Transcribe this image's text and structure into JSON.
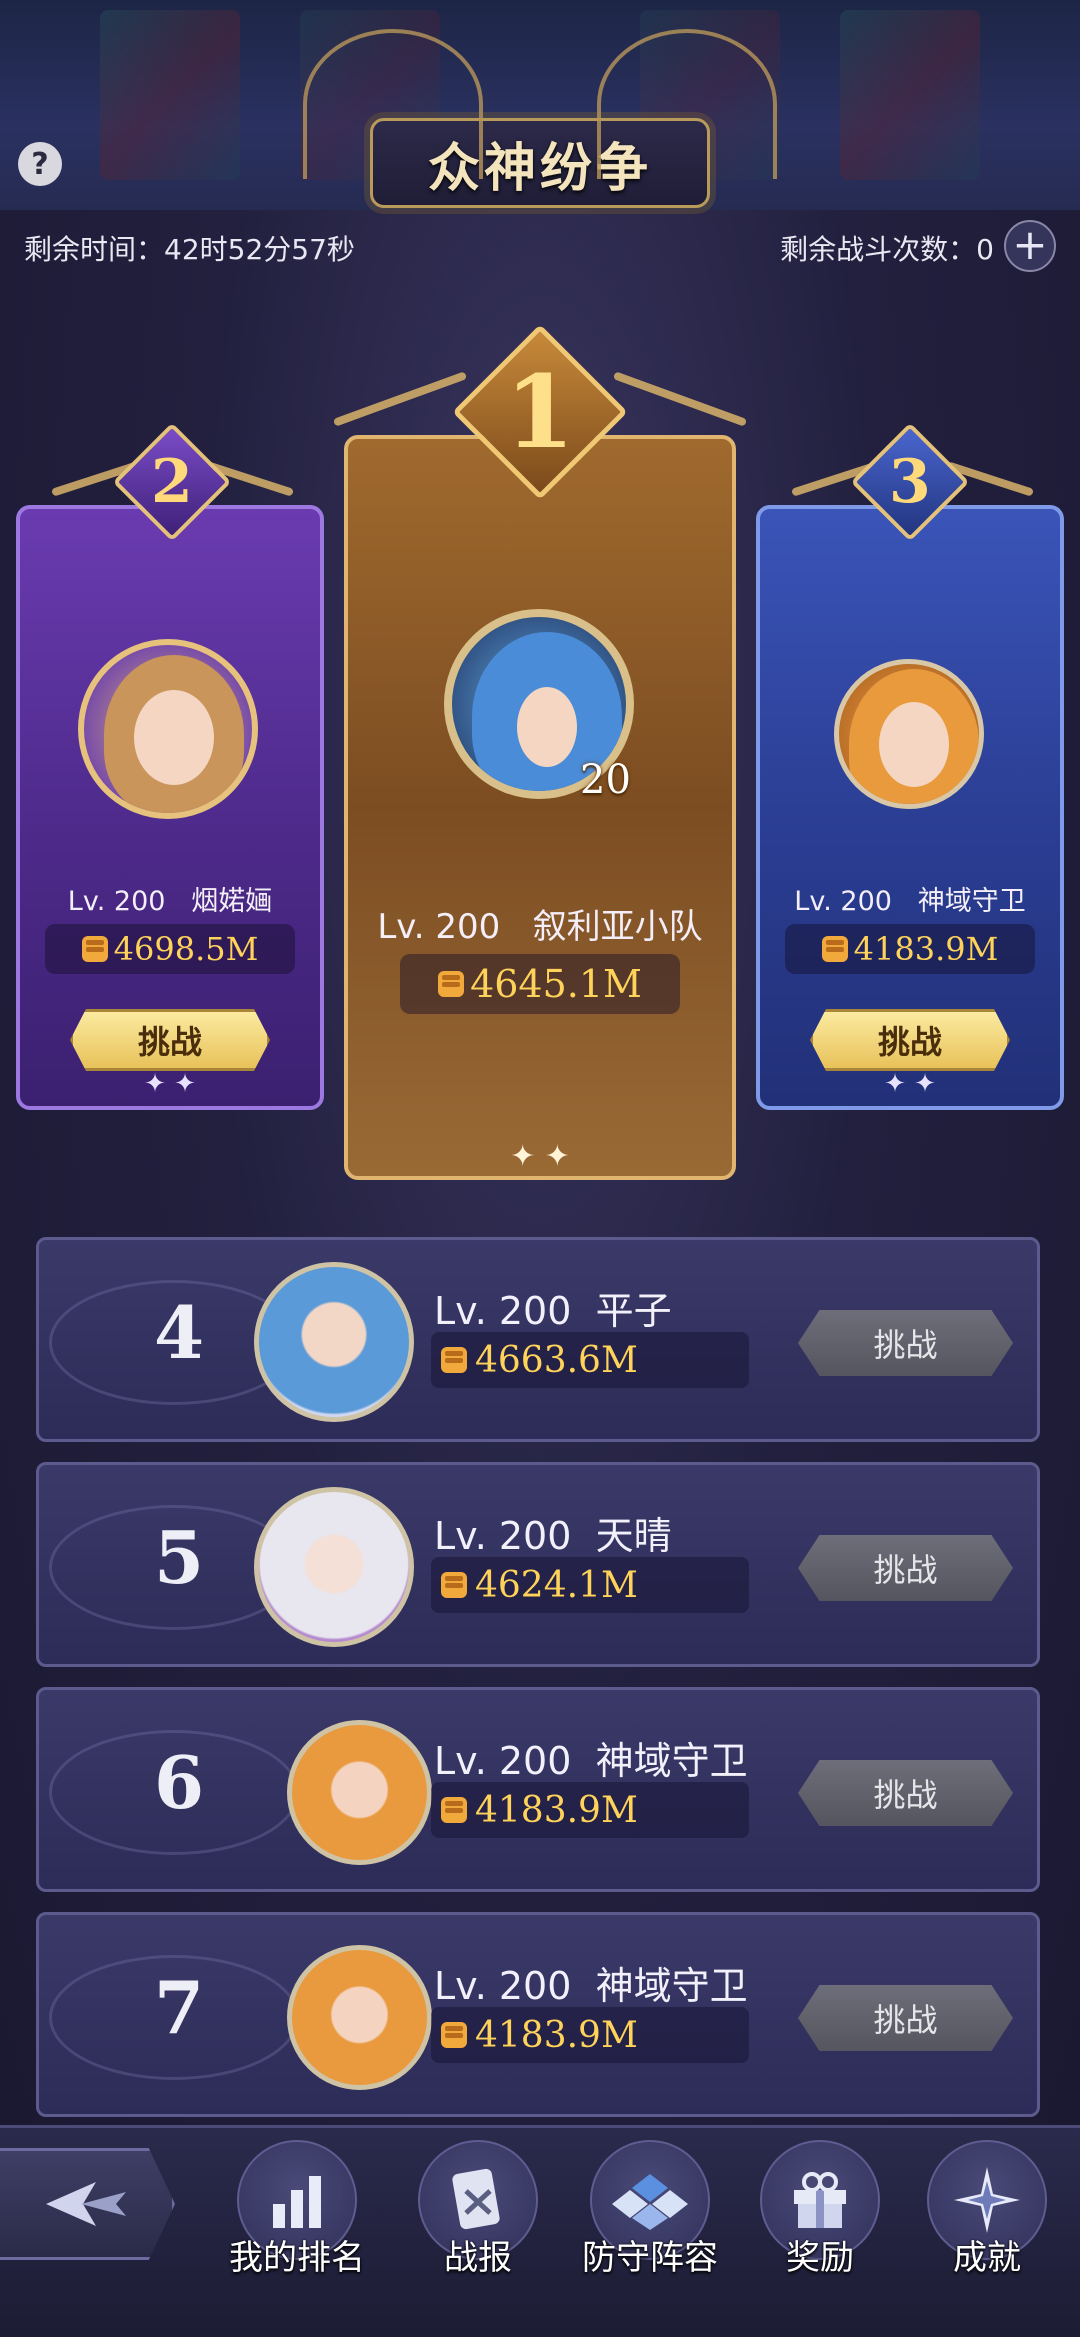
{
  "header": {
    "title": "众神纷争",
    "time_left": "剩余时间：42时52分57秒",
    "battles_left": "剩余战斗次数：0",
    "plus_label": "+",
    "help_label": "?"
  },
  "podium": [
    {
      "rank": "1",
      "level": "Lv. 200",
      "name": "叙利亚小队",
      "power": "4645.1M",
      "avatar_level": "20"
    },
    {
      "rank": "2",
      "level": "Lv. 200",
      "name": "烟婼婳",
      "power": "4698.5M",
      "button": "挑战"
    },
    {
      "rank": "3",
      "level": "Lv. 200",
      "name": "神域守卫",
      "power": "4183.9M",
      "button": "挑战"
    }
  ],
  "sparkle": "✦ ✦",
  "list": [
    {
      "rank": "4",
      "level": "Lv. 200",
      "name": "平子",
      "power": "4663.6M",
      "button": "挑战"
    },
    {
      "rank": "5",
      "level": "Lv. 200",
      "name": "天晴",
      "power": "4624.1M",
      "button": "挑战"
    },
    {
      "rank": "6",
      "level": "Lv. 200",
      "name": "神域守卫",
      "power": "4183.9M",
      "button": "挑战"
    },
    {
      "rank": "7",
      "level": "Lv. 200",
      "name": "神域守卫",
      "power": "4183.9M",
      "button": "挑战"
    }
  ],
  "nav": {
    "my_rank": "我的排名",
    "battle_report": "战报",
    "defense_lineup": "防守阵容",
    "rewards": "奖励",
    "achievements": "成就"
  },
  "colors": {
    "gold_text": "#ffd35a",
    "card_1": "#a06a2e",
    "card_2": "#6a3bb0",
    "card_3": "#3a54b8",
    "row_bg": "#3a3968"
  }
}
